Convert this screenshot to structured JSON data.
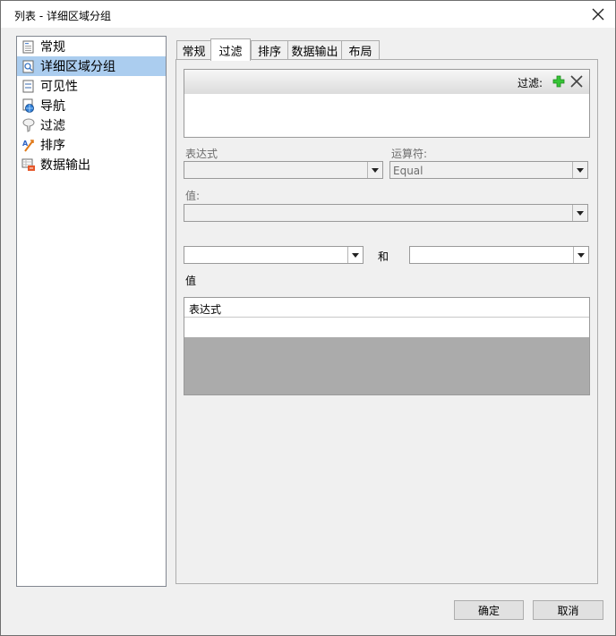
{
  "window": {
    "title": "列表 - 详细区域分组"
  },
  "nav": {
    "items": [
      {
        "label": "常规",
        "icon": "general-page-icon"
      },
      {
        "label": "详细区域分组",
        "icon": "group-page-icon"
      },
      {
        "label": "可见性",
        "icon": "visibility-page-icon"
      },
      {
        "label": "导航",
        "icon": "navigation-globe-icon"
      },
      {
        "label": "过滤",
        "icon": "filter-funnel-icon"
      },
      {
        "label": "排序",
        "icon": "sort-icon"
      },
      {
        "label": "数据输出",
        "icon": "data-output-icon"
      }
    ],
    "selected_index": 1
  },
  "tabs": [
    {
      "label": "常规"
    },
    {
      "label": "过滤"
    },
    {
      "label": "排序"
    },
    {
      "label": "数据输出"
    },
    {
      "label": "布局"
    }
  ],
  "active_tab_index": 1,
  "filter": {
    "header_label": "过滤:",
    "expression_label": "表达式",
    "operator_label": "运算符:",
    "operator_value": "Equal",
    "value_label": "值:",
    "and_label": "和",
    "value_section_label": "值",
    "grid_column": "表达式"
  },
  "footer": {
    "ok_label": "确定",
    "cancel_label": "取消"
  },
  "colors": {
    "selection": "#abcdef",
    "add_green": "#22aa22"
  }
}
